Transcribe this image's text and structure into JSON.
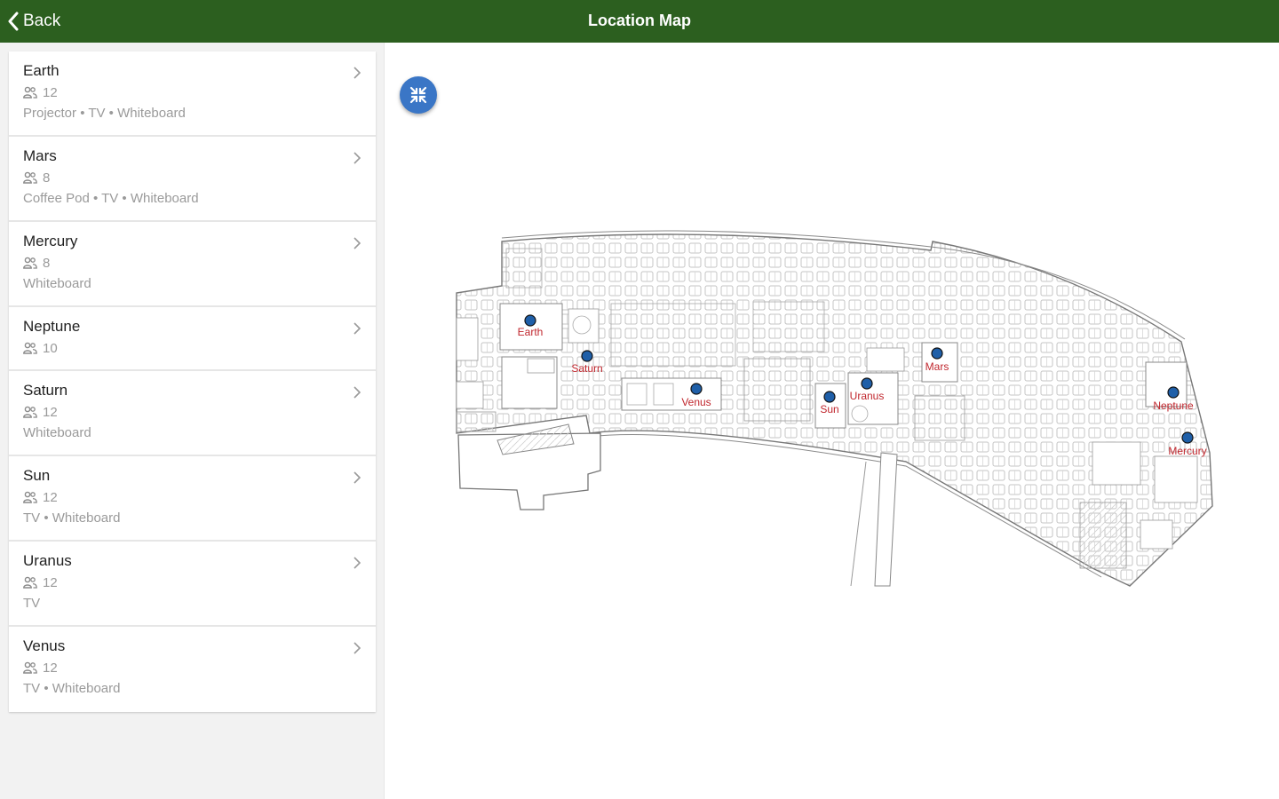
{
  "header": {
    "back_label": "Back",
    "title": "Location Map"
  },
  "rooms": [
    {
      "name": "Earth",
      "capacity": "12",
      "amenities": "Projector • TV • Whiteboard"
    },
    {
      "name": "Mars",
      "capacity": "8",
      "amenities": "Coffee Pod • TV • Whiteboard"
    },
    {
      "name": "Mercury",
      "capacity": "8",
      "amenities": "Whiteboard"
    },
    {
      "name": "Neptune",
      "capacity": "10",
      "amenities": ""
    },
    {
      "name": "Saturn",
      "capacity": "12",
      "amenities": "Whiteboard"
    },
    {
      "name": "Sun",
      "capacity": "12",
      "amenities": "TV • Whiteboard"
    },
    {
      "name": "Uranus",
      "capacity": "12",
      "amenities": "TV"
    },
    {
      "name": "Venus",
      "capacity": "12",
      "amenities": "TV • Whiteboard"
    }
  ],
  "map": {
    "pins": [
      {
        "label": "Earth"
      },
      {
        "label": "Saturn"
      },
      {
        "label": "Venus"
      },
      {
        "label": "Sun"
      },
      {
        "label": "Uranus"
      },
      {
        "label": "Mars"
      },
      {
        "label": "Neptune"
      },
      {
        "label": "Mercury"
      }
    ],
    "pin_color": "#1f5fa8",
    "label_color": "#c0262d"
  },
  "colors": {
    "header": "#2c5f1f",
    "fullscreen_button": "#3a76c6",
    "sidebar_bg": "#f2f2f2"
  },
  "icons": {
    "back": "chevron-left-icon",
    "capacity": "people-icon",
    "row": "chevron-right-icon",
    "fullscreen": "collapse-arrows-icon"
  }
}
